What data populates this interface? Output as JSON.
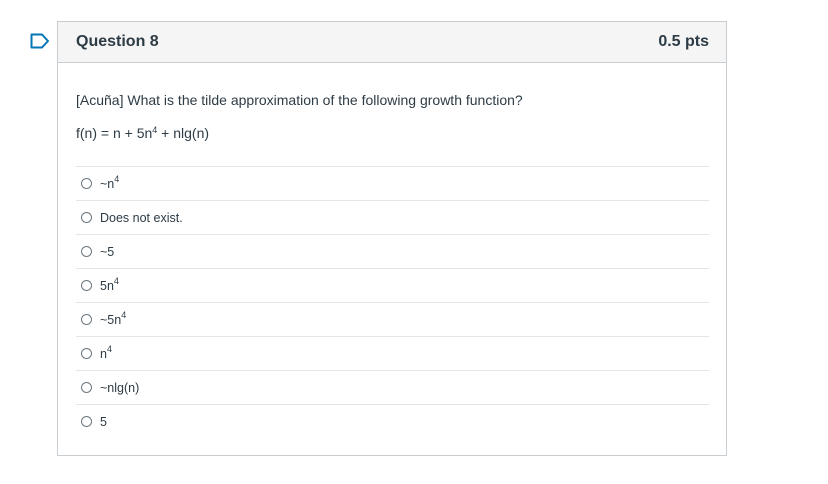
{
  "question": {
    "title": "Question 8",
    "points": "0.5 pts",
    "text": "[Acuña] What is the tilde approximation of the following growth function?",
    "formula_prefix": "f(n) = n + 5n",
    "formula_exp": "4",
    "formula_suffix": " + nlg(n)"
  },
  "answers": [
    {
      "base": "~n",
      "exp": "4"
    },
    {
      "base": "Does not exist.",
      "exp": ""
    },
    {
      "base": "~5",
      "exp": ""
    },
    {
      "base": "5n",
      "exp": "4"
    },
    {
      "base": "~5n",
      "exp": "4"
    },
    {
      "base": "n",
      "exp": "4"
    },
    {
      "base": "~nlg(n)",
      "exp": ""
    },
    {
      "base": "5",
      "exp": ""
    }
  ],
  "colors": {
    "flag": "#0374b5",
    "header_bg": "#f5f5f5",
    "border": "#c7cdd1",
    "text": "#2d3b45"
  },
  "icons": {
    "flag": "flag-icon"
  }
}
